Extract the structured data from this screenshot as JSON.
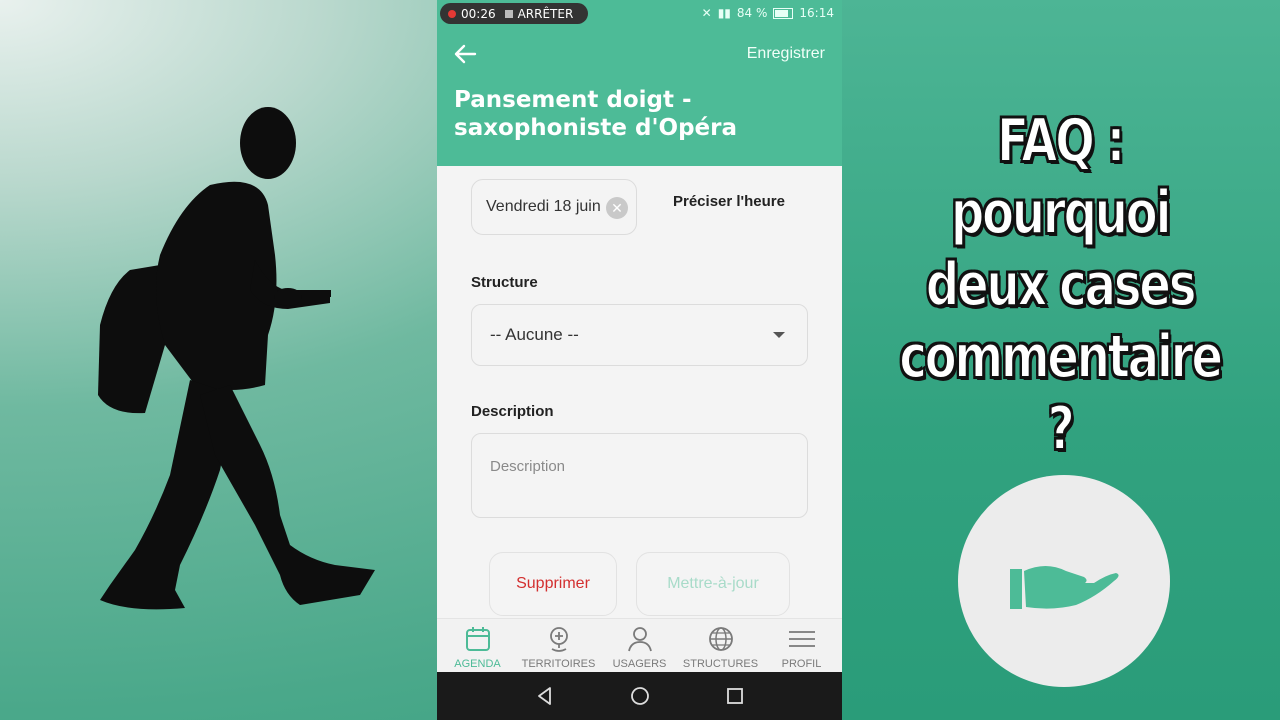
{
  "status_bar": {
    "recording_time": "00:26",
    "stop_label": "ARRÊTER",
    "battery": "84 %",
    "clock": "16:14"
  },
  "header": {
    "save_label": "Enregistrer",
    "title": "Pansement doigt - saxophoniste d'Opéra"
  },
  "form": {
    "date_chip": "Vendredi 18 juin",
    "time_link": "Préciser l'heure",
    "structure_label": "Structure",
    "structure_value": "-- Aucune --",
    "description_label": "Description",
    "description_placeholder": "Description",
    "delete_button": "Supprimer",
    "update_button": "Mettre-à-jour"
  },
  "bottom_nav": {
    "items": [
      {
        "label": "AGENDA",
        "icon": "calendar-icon",
        "active": true
      },
      {
        "label": "TERRITOIRES",
        "icon": "map-pin-icon",
        "active": false
      },
      {
        "label": "USAGERS",
        "icon": "user-icon",
        "active": false
      },
      {
        "label": "STRUCTURES",
        "icon": "globe-icon",
        "active": false
      },
      {
        "label": "PROFIL",
        "icon": "menu-icon",
        "active": false
      }
    ]
  },
  "overlay": {
    "faq_lines": [
      "FAQ : pourquoi",
      "deux cases",
      "commentaire",
      "?"
    ]
  },
  "colors": {
    "primary": "#4dbb97",
    "danger": "#d32f2f",
    "disabled": "#a8dbc9"
  }
}
